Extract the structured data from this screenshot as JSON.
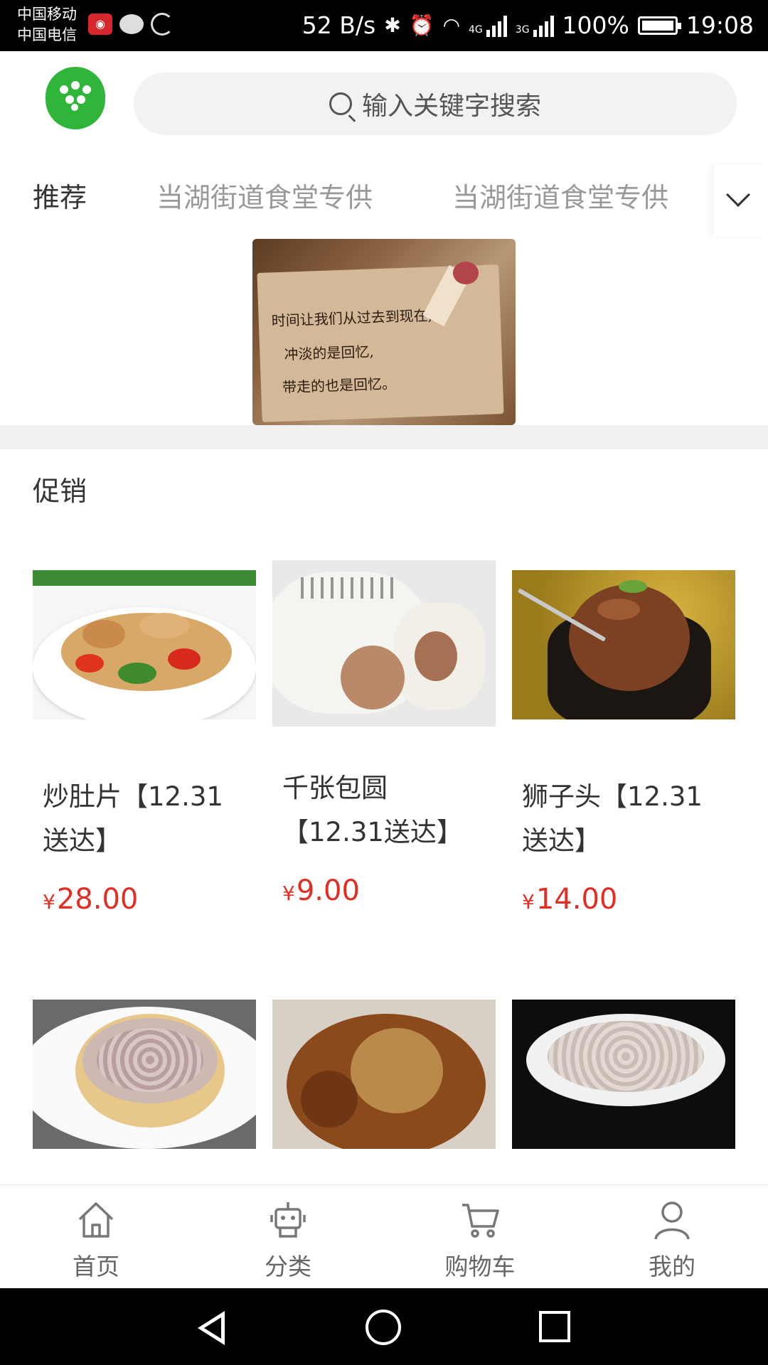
{
  "status_bar": {
    "carrier_1": "中国移动",
    "carrier_2": "中国电信",
    "speed": "52 B/s",
    "net_1": "4G",
    "net_2": "3G",
    "battery": "100%",
    "battery_level": 1.0,
    "time": "19:08"
  },
  "search": {
    "placeholder": "输入关键字搜索"
  },
  "tabs": [
    {
      "label": "推荐",
      "active": true
    },
    {
      "label": "当湖街道食堂专供",
      "active": false
    },
    {
      "label": "当湖街道食堂专供",
      "active": false
    }
  ],
  "banner": {
    "lines": [
      "时间让我们从过去到现在,",
      "冲淡的是回忆,",
      "带走的也是回忆。"
    ]
  },
  "section": {
    "title": "促销"
  },
  "products": [
    {
      "name": "炒肚片【12.31送达】",
      "currency": "¥",
      "price": "28.00"
    },
    {
      "name": "千张包圆【12.31送达】",
      "currency": "¥",
      "price": "9.00"
    },
    {
      "name": "狮子头【12.31送达】",
      "currency": "¥",
      "price": "14.00"
    }
  ],
  "nav": [
    {
      "label": "首页",
      "icon": "home-icon"
    },
    {
      "label": "分类",
      "icon": "category-icon"
    },
    {
      "label": "购物车",
      "icon": "cart-icon"
    },
    {
      "label": "我的",
      "icon": "user-icon"
    }
  ],
  "colors": {
    "accent": "#e02e24",
    "logo": "#2fb53a"
  }
}
